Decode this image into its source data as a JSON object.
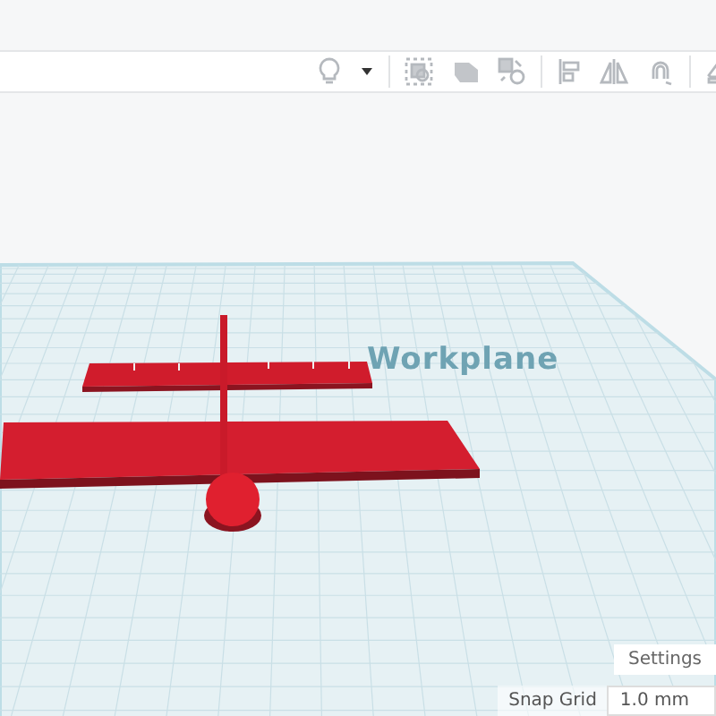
{
  "workplane_label": "Workplane",
  "settings_button": "Settings",
  "snap_grid": {
    "label": "Snap Grid",
    "value": "1.0 mm"
  }
}
